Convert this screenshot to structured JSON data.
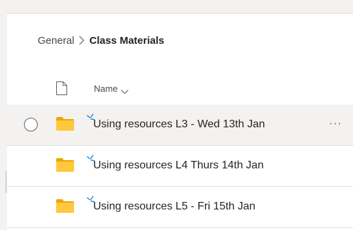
{
  "breadcrumb": {
    "parent": "General",
    "current": "Class Materials"
  },
  "columns": {
    "name": "Name"
  },
  "rows": [
    {
      "label": "Using resources L3 - Wed 13th Jan",
      "selected": true
    },
    {
      "label": "Using resources L4 Thurs 14th Jan",
      "selected": false
    },
    {
      "label": "Using resources L5 - Fri 15th Jan",
      "selected": false
    }
  ],
  "icons": {
    "folder": "folder-icon",
    "new": "new-item-icon",
    "file_type": "file-icon",
    "more": "more-actions-icon",
    "separator": "chevron-right-icon",
    "sort": "chevron-down-icon"
  },
  "colors": {
    "folder": "#ffb900",
    "new_indicator": "#0078d4",
    "selected_row": "#f3f2f1"
  },
  "more_glyph": "···"
}
